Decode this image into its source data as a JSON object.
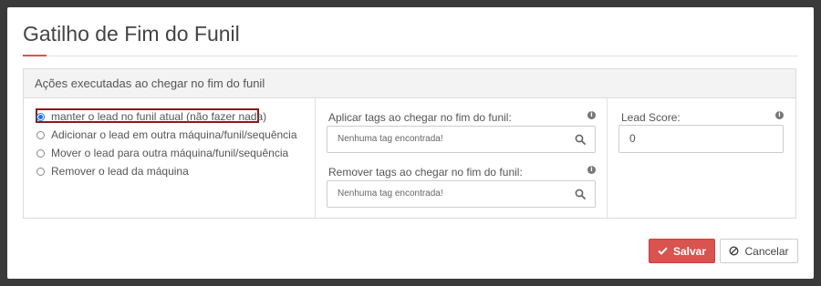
{
  "dialog": {
    "title": "Gatilho de Fim do Funil",
    "panel_heading": "Ações executadas ao chegar no fim do funil"
  },
  "actions": {
    "options": [
      {
        "label": "manter o lead no funil atual (não fazer nada)",
        "selected": true
      },
      {
        "label": "Adicionar o lead em outra máquina/funil/sequência",
        "selected": false
      },
      {
        "label": "Mover o lead para outra máquina/funil/sequência",
        "selected": false
      },
      {
        "label": "Remover o lead da máquina",
        "selected": false
      }
    ]
  },
  "tags": {
    "apply_label": "Aplicar tags ao chegar no fim do funil:",
    "apply_placeholder": "Nenhuma tag encontrada!",
    "remove_label": "Remover tags ao chegar no fim do funil:",
    "remove_placeholder": "Nenhuma tag encontrada!"
  },
  "score": {
    "label": "Lead Score:",
    "value": "0"
  },
  "footer": {
    "save_label": "Salvar",
    "cancel_label": "Cancelar"
  },
  "colors": {
    "accent": "#d9534f",
    "radio_selected": "#1a73e8",
    "highlight_border": "#8b1a1a"
  },
  "icons": {
    "info": "info-circle-icon",
    "search": "search-icon",
    "save": "check-icon",
    "cancel": "ban-icon"
  }
}
